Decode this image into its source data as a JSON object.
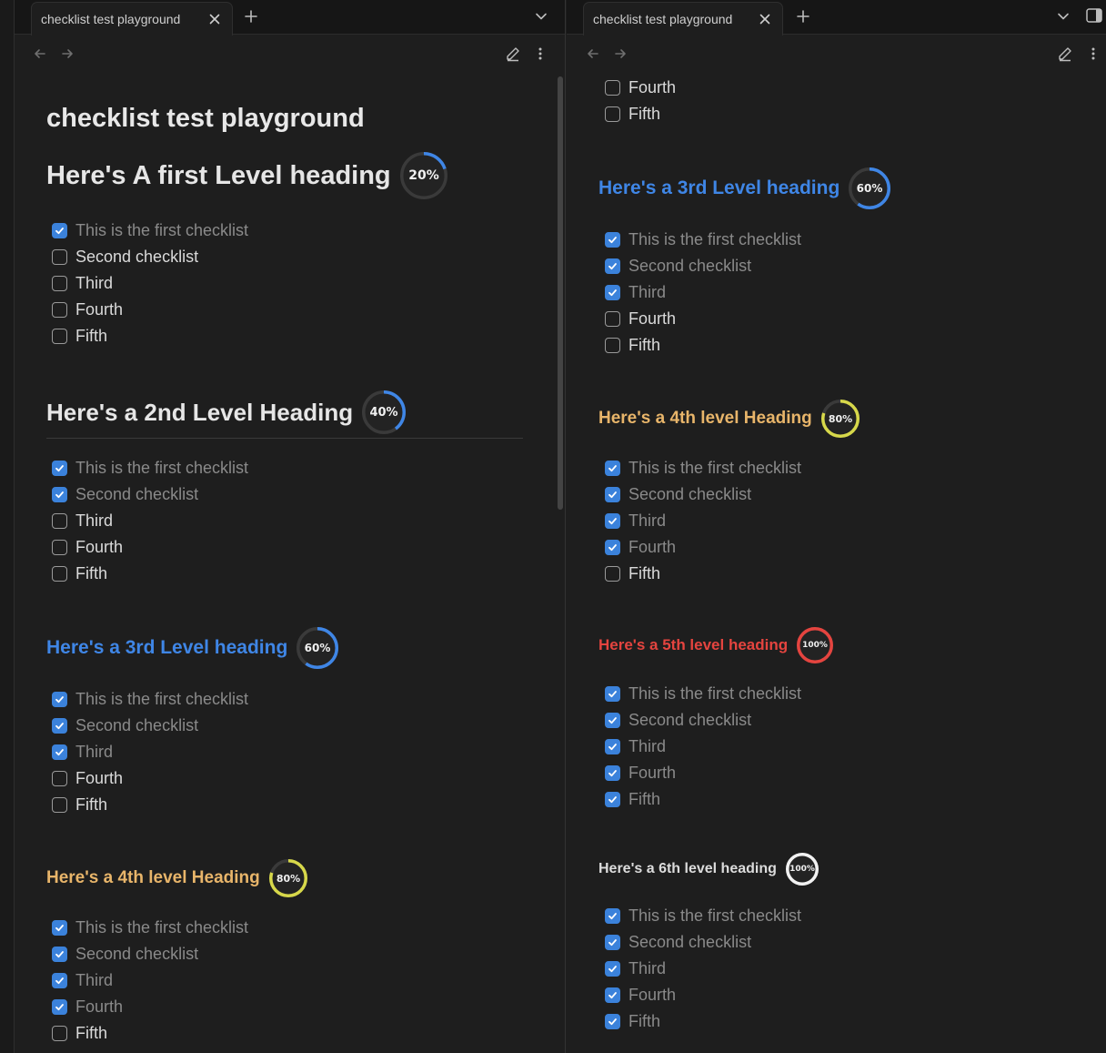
{
  "colors": {
    "h3": "#3f86e6",
    "h4": "#e8b56a",
    "h5": "#e5443f",
    "h6": "#dcdcdc",
    "checkbox_checked": "#3b82db",
    "ring_20": "#3f86e6",
    "ring_40": "#3f86e6",
    "ring_60": "#3f86e6",
    "ring_80": "#d7d84a",
    "ring_100_red": "#e5443f",
    "ring_100_white": "#f2f2f2"
  },
  "tabs": {
    "left": {
      "label": "checklist test playground"
    },
    "right": {
      "label": "checklist test playground"
    }
  },
  "icons": {
    "tab_close": "close-icon",
    "new_tab": "plus-icon",
    "tab_list": "chevron-down-icon",
    "sidebar_toggle": "sidebar-toggle-icon",
    "back": "arrow-left-icon",
    "forward": "arrow-right-icon",
    "edit": "pencil-icon",
    "more": "more-vertical-icon"
  },
  "left_pane": {
    "note_title": "checklist test playground",
    "sections": [
      {
        "level": 1,
        "heading": "Here's A first Level heading",
        "progress_percent": 20,
        "progress_label": "20%",
        "items": [
          {
            "text": "This is the first checklist",
            "checked": true
          },
          {
            "text": "Second checklist",
            "checked": false
          },
          {
            "text": "Third",
            "checked": false
          },
          {
            "text": "Fourth",
            "checked": false
          },
          {
            "text": "Fifth",
            "checked": false
          }
        ]
      },
      {
        "level": 2,
        "heading": "Here's a 2nd Level Heading",
        "progress_percent": 40,
        "progress_label": "40%",
        "items": [
          {
            "text": "This is the first checklist",
            "checked": true
          },
          {
            "text": "Second checklist",
            "checked": true
          },
          {
            "text": "Third",
            "checked": false
          },
          {
            "text": "Fourth",
            "checked": false
          },
          {
            "text": "Fifth",
            "checked": false
          }
        ]
      },
      {
        "level": 3,
        "heading": "Here's a 3rd Level heading",
        "progress_percent": 60,
        "progress_label": "60%",
        "items": [
          {
            "text": "This is the first checklist",
            "checked": true
          },
          {
            "text": "Second checklist",
            "checked": true
          },
          {
            "text": "Third",
            "checked": true
          },
          {
            "text": "Fourth",
            "checked": false
          },
          {
            "text": "Fifth",
            "checked": false
          }
        ]
      },
      {
        "level": 4,
        "heading": "Here's a 4th level Heading",
        "progress_percent": 80,
        "progress_label": "80%",
        "items": [
          {
            "text": "This is the first checklist",
            "checked": true
          },
          {
            "text": "Second checklist",
            "checked": true
          },
          {
            "text": "Third",
            "checked": true
          },
          {
            "text": "Fourth",
            "checked": true
          },
          {
            "text": "Fifth",
            "checked": false
          }
        ]
      }
    ]
  },
  "right_pane": {
    "top_items": [
      {
        "text": "Fourth",
        "checked": false
      },
      {
        "text": "Fifth",
        "checked": false
      }
    ],
    "sections": [
      {
        "level": 3,
        "heading": "Here's a 3rd Level heading",
        "progress_percent": 60,
        "progress_label": "60%",
        "items": [
          {
            "text": "This is the first checklist",
            "checked": true
          },
          {
            "text": "Second checklist",
            "checked": true
          },
          {
            "text": "Third",
            "checked": true
          },
          {
            "text": "Fourth",
            "checked": false
          },
          {
            "text": "Fifth",
            "checked": false
          }
        ]
      },
      {
        "level": 4,
        "heading": "Here's a 4th level Heading",
        "progress_percent": 80,
        "progress_label": "80%",
        "items": [
          {
            "text": "This is the first checklist",
            "checked": true
          },
          {
            "text": "Second checklist",
            "checked": true
          },
          {
            "text": "Third",
            "checked": true
          },
          {
            "text": "Fourth",
            "checked": true
          },
          {
            "text": "Fifth",
            "checked": false
          }
        ]
      },
      {
        "level": 5,
        "heading": "Here's a 5th level heading",
        "progress_percent": 100,
        "progress_label": "100%",
        "items": [
          {
            "text": "This is the first checklist",
            "checked": true
          },
          {
            "text": "Second checklist",
            "checked": true
          },
          {
            "text": "Third",
            "checked": true
          },
          {
            "text": "Fourth",
            "checked": true
          },
          {
            "text": "Fifth",
            "checked": true
          }
        ]
      },
      {
        "level": 6,
        "heading": "Here's a 6th level heading",
        "progress_percent": 100,
        "progress_label": "100%",
        "items": [
          {
            "text": "This is the first checklist",
            "checked": true
          },
          {
            "text": "Second checklist",
            "checked": true
          },
          {
            "text": "Third",
            "checked": true
          },
          {
            "text": "Fourth",
            "checked": true
          },
          {
            "text": "Fifth",
            "checked": true
          }
        ]
      }
    ]
  }
}
